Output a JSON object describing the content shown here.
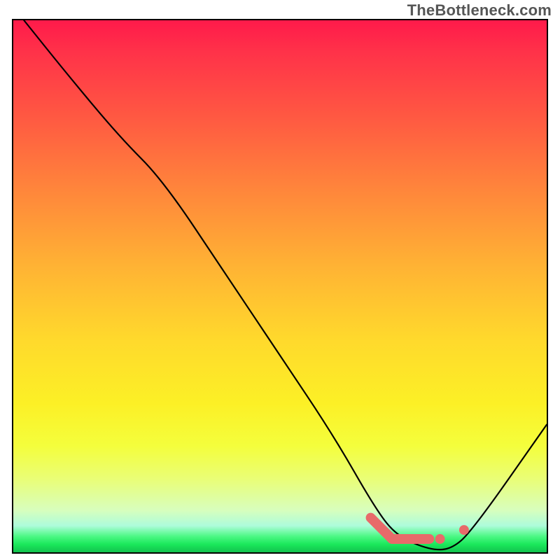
{
  "attribution": "TheBottleneck.com",
  "chart_data": {
    "type": "line",
    "title": "",
    "xlabel": "",
    "ylabel": "",
    "xlim": [
      0,
      100
    ],
    "ylim": [
      0,
      100
    ],
    "series": [
      {
        "name": "bottleneck-curve",
        "x": [
          2,
          10,
          20,
          28,
          40,
          50,
          60,
          68,
          72,
          78,
          82,
          86,
          100
        ],
        "y": [
          100,
          90,
          78,
          70,
          52,
          37,
          22,
          8,
          3,
          0.5,
          0.5,
          4,
          24
        ]
      }
    ],
    "markers": [
      {
        "name": "threshold-segment",
        "x_start": 67.0,
        "x_end": 71.0,
        "y_start": 6.5,
        "y_end": 2.5,
        "style": "thick"
      },
      {
        "name": "flat-segment",
        "x_start": 71.0,
        "x_end": 78.0,
        "y_start": 2.5,
        "y_end": 2.5,
        "style": "thick"
      },
      {
        "name": "dot-1",
        "x": 80.0,
        "y": 2.5,
        "style": "dot"
      },
      {
        "name": "dot-2",
        "x": 84.5,
        "y": 4.2,
        "style": "dot"
      }
    ],
    "marker_color": "#e86a6a",
    "gradient_stops": [
      {
        "pos": 0.0,
        "color": "#ff1a4a"
      },
      {
        "pos": 0.5,
        "color": "#ffc630"
      },
      {
        "pos": 0.8,
        "color": "#f4fe3c"
      },
      {
        "pos": 0.97,
        "color": "#4cf884"
      },
      {
        "pos": 1.0,
        "color": "#12c24e"
      }
    ]
  }
}
